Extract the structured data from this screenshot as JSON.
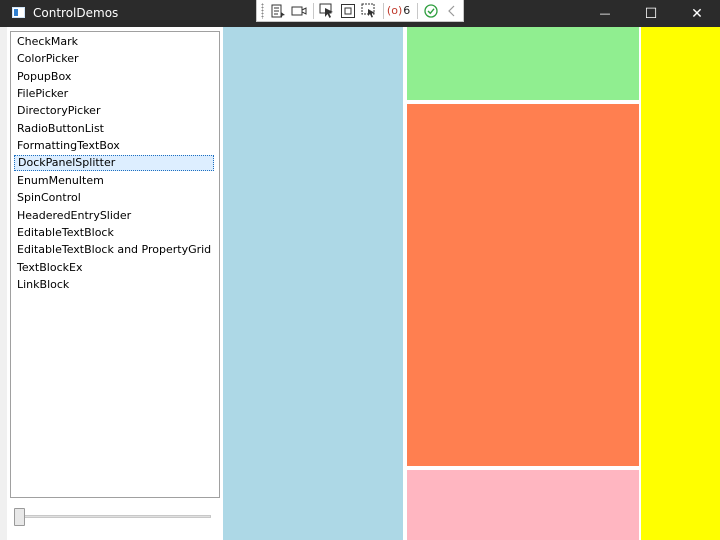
{
  "window": {
    "title": "ControlDemos",
    "minimize_glyph": "—",
    "maximize_glyph": "☐",
    "close_glyph": "✕"
  },
  "debug_toolbar": {
    "binding_error_count": "6",
    "items": [
      "live-visual-tree-icon",
      "record-icon",
      "select-element-icon",
      "display-layout-adorners-icon",
      "track-focus-icon",
      "binding-failures-icon",
      "hot-reload-ok-icon",
      "collapse-icon"
    ]
  },
  "sidebar": {
    "items": [
      "CheckMark",
      "ColorPicker",
      "PopupBox",
      "FilePicker",
      "DirectoryPicker",
      "RadioButtonList",
      "FormattingTextBox",
      "DockPanelSplitter",
      "EnumMenuItem",
      "SpinControl",
      "HeaderedEntrySlider",
      "EditableTextBlock",
      "EditableTextBlock and PropertyGrid",
      "TextBlockEx",
      "LinkBlock"
    ],
    "selected_index": 7,
    "slider_value": 0
  },
  "colors": {
    "left_panel": "#add8e6",
    "top_panel": "#90ee90",
    "center_panel": "#ff7f50",
    "bottom_panel": "#ffb6c1",
    "right_panel": "#ffff00"
  }
}
